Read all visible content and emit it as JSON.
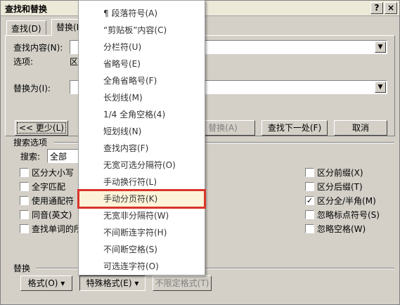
{
  "window": {
    "title": "查找和替换"
  },
  "titlebar": {
    "help": "?",
    "close": "×"
  },
  "tabs": [
    {
      "label": "查找(D)"
    },
    {
      "label": "替换(P)"
    }
  ],
  "find": {
    "label": "查找内容(N):",
    "value": ""
  },
  "options": {
    "label": "选项:",
    "value": "区"
  },
  "replace": {
    "label": "替换为(I):",
    "value": ""
  },
  "buttons": {
    "less": "<< 更少(L)",
    "replace_all": "替换(A)",
    "find_next": "查找下一处(F)",
    "cancel": "取消"
  },
  "search_options": {
    "heading": "搜索选项",
    "search_label": "搜索:",
    "search_value": "全部"
  },
  "left_checks": [
    {
      "label": "区分大小写",
      "checked": false
    },
    {
      "label": "全字匹配",
      "checked": false
    },
    {
      "label": "使用通配符",
      "checked": false
    },
    {
      "label": "同音(英文)",
      "checked": false
    },
    {
      "label": "查找单词的所",
      "checked": false
    }
  ],
  "right_checks": [
    {
      "label": "区分前缀(X)",
      "checked": false
    },
    {
      "label": "区分后缀(T)",
      "checked": false
    },
    {
      "label": "区分全/半角(M)",
      "checked": true,
      "mark": "✓"
    },
    {
      "label": "忽略标点符号(S)",
      "checked": false
    },
    {
      "label": "忽略空格(W)",
      "checked": false
    }
  ],
  "replace_section": {
    "heading": "替换",
    "format": "格式(O) ▾",
    "special": "特殊格式(E) ▾",
    "no_format": "不限定格式(T)"
  },
  "menu": {
    "items": [
      "¶ 段落符号(A)",
      "“剪贴板”内容(C)",
      "分栏符(U)",
      "省略号(E)",
      "全角省略号(F)",
      "长划线(M)",
      "1/4 全角空格(4)",
      "短划线(N)",
      "查找内容(F)",
      "无宽可选分隔符(O)",
      "手动换行符(L)",
      "手动分页符(K)",
      "无宽非分隔符(W)",
      "不间断连字符(H)",
      "不间断空格(S)",
      "可选连字符(O)"
    ],
    "highlighted_index": 11,
    "highlight_color": "#d9342b"
  }
}
